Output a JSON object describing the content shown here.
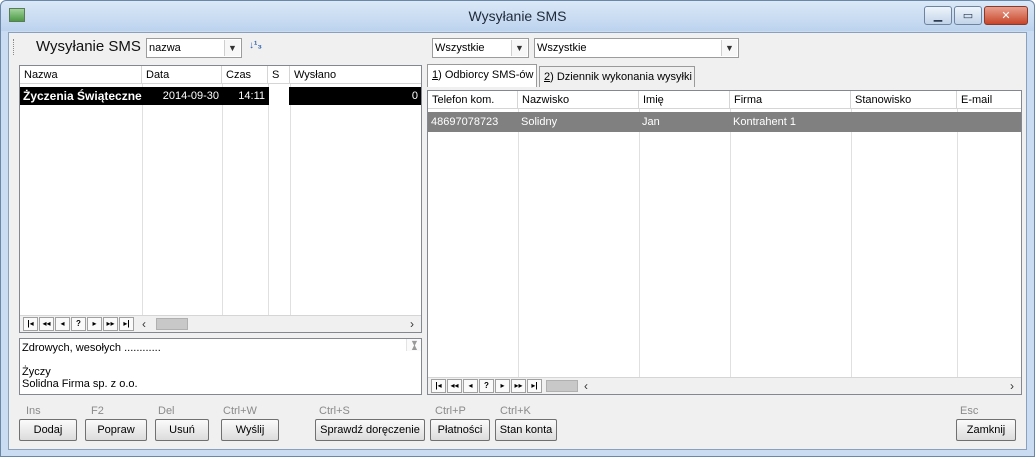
{
  "window": {
    "title": "Wysyłanie SMS",
    "buttons": [
      "minimize",
      "maximize",
      "close"
    ]
  },
  "toolbar": {
    "title": "Wysyłanie SMS",
    "search_field": "nazwa",
    "filter1": "Wszystkie",
    "filter2": "Wszystkie"
  },
  "messages": {
    "columns": [
      "Nazwa",
      "Data",
      "Czas",
      "S",
      "Wysłano"
    ],
    "rows": [
      {
        "name": "Życzenia Świąteczne",
        "date": "2014-09-30",
        "time": "14:11",
        "status": "",
        "sent": "0"
      }
    ],
    "nav": [
      "|◂",
      "◂◂",
      "◂",
      "?",
      "▸",
      "▸▸",
      "▸|"
    ]
  },
  "memo": {
    "lines": [
      "Zdrowych, wesołych ............",
      "",
      "Życzy",
      "Solidna Firma sp. z o.o."
    ]
  },
  "tabs": [
    {
      "key": "1",
      "label": ") Odbiorcy SMS-ów"
    },
    {
      "key": "2",
      "label": ") Dziennik wykonania wysyłki"
    }
  ],
  "recipients": {
    "columns": [
      "Telefon kom.",
      "Nazwisko",
      "Imię",
      "Firma",
      "Stanowisko",
      "E-mail"
    ],
    "rows": [
      {
        "phone": "48697078723",
        "surname": "Solidny",
        "firstname": "Jan",
        "company": "Kontrahent 1",
        "position": "",
        "email": ""
      }
    ]
  },
  "buttons": {
    "add": {
      "hotkey": "Ins",
      "label": "Dodaj"
    },
    "edit": {
      "hotkey": "F2",
      "label": "Popraw"
    },
    "delete": {
      "hotkey": "Del",
      "label": "Usuń"
    },
    "send": {
      "hotkey": "Ctrl+W",
      "label": "Wyślij"
    },
    "check": {
      "hotkey": "Ctrl+S",
      "label": "Sprawdź doręczenie"
    },
    "payments": {
      "hotkey": "Ctrl+P",
      "label": "Płatności"
    },
    "balance": {
      "hotkey": "Ctrl+K",
      "label": "Stan konta"
    },
    "close": {
      "hotkey": "Esc",
      "label": "Zamknij"
    }
  }
}
